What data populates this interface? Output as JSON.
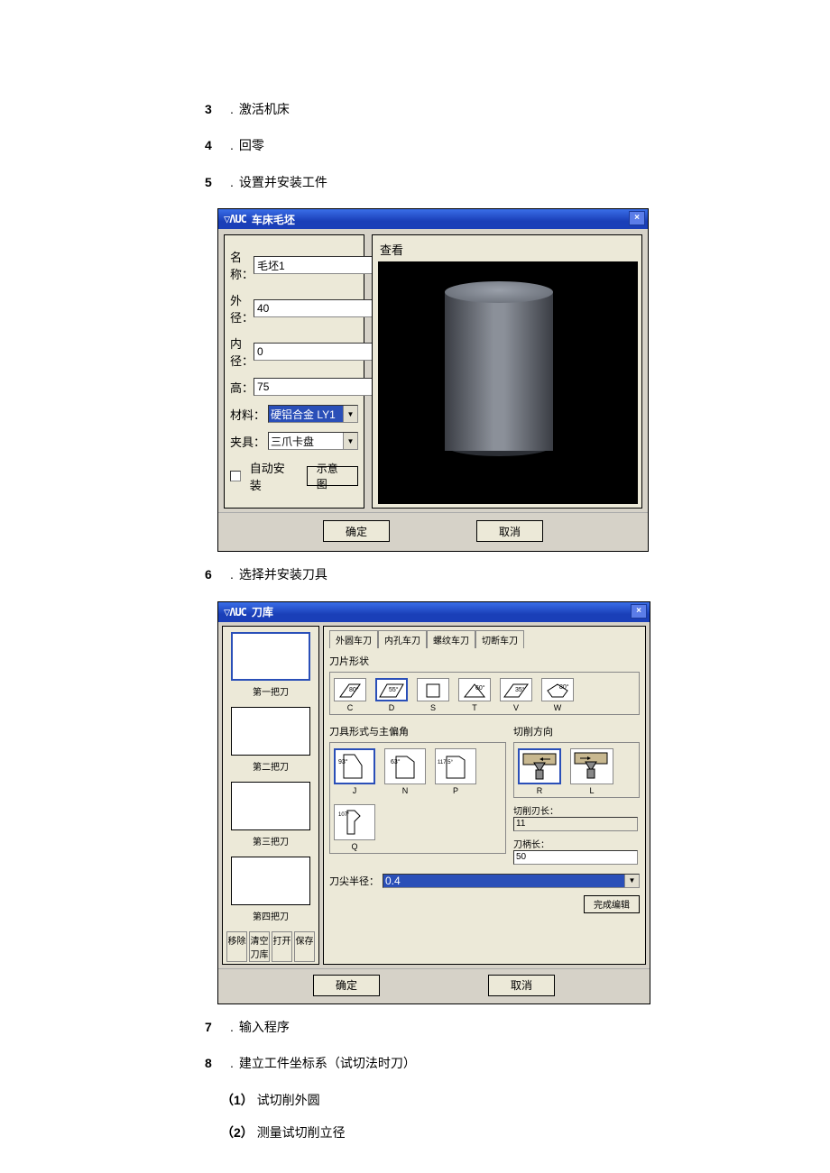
{
  "steps": {
    "s3": {
      "num": "3",
      "text": "激活机床"
    },
    "s4": {
      "num": "4",
      "text": "回零"
    },
    "s5": {
      "num": "5",
      "text": "设置并安装工件"
    },
    "s6": {
      "num": "6",
      "text": "选择并安装刀具"
    },
    "s7": {
      "num": "7",
      "text": "输入程序"
    },
    "s8": {
      "num": "8",
      "text": "建立工件坐标系（试切法时刀）"
    },
    "s8_1": {
      "num": "（1）",
      "text": "试切削外圆"
    },
    "s8_2": {
      "num": "（2）",
      "text": "测量试切削立径"
    }
  },
  "dlg1": {
    "logo": "▽ΛUC",
    "title": "车床毛坯",
    "close": "×",
    "view_label": "查看",
    "name_label": "名称：",
    "name_value": "毛坯1",
    "od_label": "外径：",
    "od_value": "40",
    "id_label": "内径：",
    "id_value": "0",
    "h_label": "高：",
    "h_value": "75",
    "mat_label": "材料：",
    "mat_value": "硬铝合金 LY1",
    "fix_label": "夹具：",
    "fix_value": "三爪卡盘",
    "auto_label": "自动安装",
    "diagram_btn": "示意图",
    "ok": "确定",
    "cancel": "取消"
  },
  "dlg2": {
    "logo": "▽ΛUC",
    "title": "刀库",
    "close": "×",
    "thumbs": [
      "第一把刀",
      "第二把刀",
      "第三把刀",
      "第四把刀"
    ],
    "thumb_btns": [
      "移除",
      "清空刀库",
      "打开",
      "保存"
    ],
    "tabs": [
      "外圆车刀",
      "内孔车刀",
      "螺纹车刀",
      "切断车刀"
    ],
    "shape_label": "刀片形状",
    "shapes": [
      {
        "lab": "C",
        "txt": "80°"
      },
      {
        "lab": "D",
        "txt": "55°"
      },
      {
        "lab": "S",
        "txt": ""
      },
      {
        "lab": "T",
        "txt": "60°"
      },
      {
        "lab": "V",
        "txt": "35°"
      },
      {
        "lab": "W",
        "txt": "80°"
      }
    ],
    "style_label": "刀具形式与主偏角",
    "styles": [
      {
        "lab": "J",
        "txt": "93°"
      },
      {
        "lab": "N",
        "txt": "63°"
      },
      {
        "lab": "P",
        "txt": "117.5°"
      },
      {
        "lab": "Q",
        "txt": "107°"
      }
    ],
    "cut_label": "切削方向",
    "cuts": [
      "R",
      "L"
    ],
    "edge_len_label": "切削刃长：",
    "edge_len_value": "11",
    "shank_len_label": "刀柄长：",
    "shank_len_value": "50",
    "radius_label": "刀尖半径：",
    "radius_value": "0.4",
    "done_btn": "完成编辑",
    "ok": "确定",
    "cancel": "取消"
  }
}
